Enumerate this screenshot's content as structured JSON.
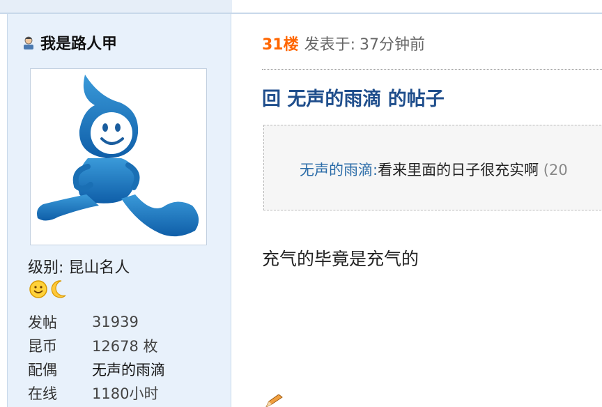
{
  "user": {
    "name": "我是路人甲",
    "level_label": "级别:",
    "level_value": "昆山名人",
    "stats": [
      {
        "label": "发帖",
        "value": "31939"
      },
      {
        "label": "昆币",
        "value": "12678 枚"
      },
      {
        "label": "配偶",
        "value": "无声的雨滴"
      },
      {
        "label": "在线",
        "value": "1180小时"
      }
    ]
  },
  "post": {
    "floor": "31楼",
    "posted_label": "发表于:",
    "posted_time": "37分钟前",
    "title": "回 无声的雨滴 的帖子",
    "quote": {
      "author": "无声的雨滴",
      "colon": ":",
      "text": "看来里面的日子很充实啊",
      "date_fragment": "(20"
    },
    "body": "充气的毕竟是充气的"
  },
  "colors": {
    "floor": "#ff6600",
    "title": "#1f4e8c",
    "link": "#2b6ca8",
    "sidebar_bg": "#e8f1fb"
  }
}
